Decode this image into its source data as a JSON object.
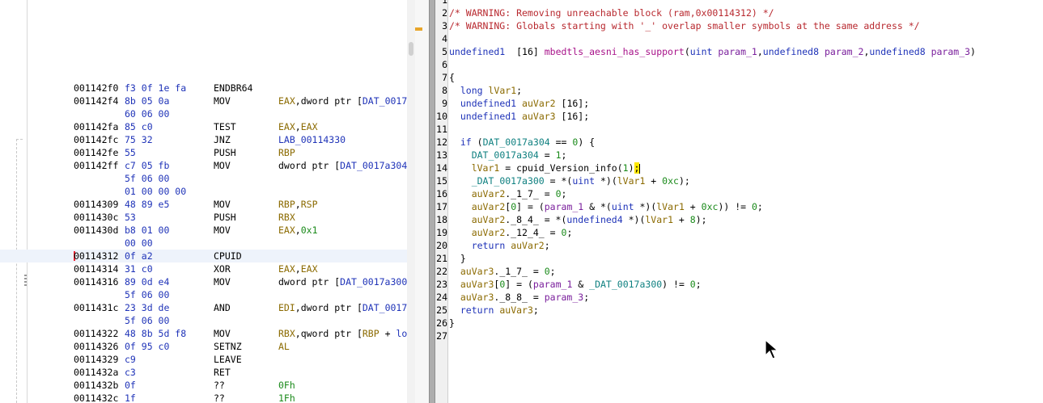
{
  "listing": {
    "rows": [
      {
        "addr": "001142f0",
        "bytes": "f3 0f 1e fa",
        "mnemonic": "ENDBR64",
        "operands": []
      },
      {
        "addr": "001142f4",
        "bytes": "8b 05 0a",
        "mnemonic": "MOV",
        "operands": [
          {
            "t": "EAX",
            "k": "reg"
          },
          {
            "t": ",dword ptr [",
            "k": "plain"
          },
          {
            "t": "DAT_0017",
            "k": "data"
          }
        ]
      },
      {
        "addr": "",
        "bytes": "60 06 00",
        "mnemonic": "",
        "operands": []
      },
      {
        "addr": "001142fa",
        "bytes": "85 c0",
        "mnemonic": "TEST",
        "operands": [
          {
            "t": "EAX",
            "k": "reg"
          },
          {
            "t": ",",
            "k": "plain"
          },
          {
            "t": "EAX",
            "k": "reg"
          }
        ]
      },
      {
        "addr": "001142fc",
        "bytes": "75 32",
        "mnemonic": "JNZ",
        "operands": [
          {
            "t": "LAB_00114330",
            "k": "lab"
          }
        ]
      },
      {
        "addr": "001142fe",
        "bytes": "55",
        "mnemonic": "PUSH",
        "operands": [
          {
            "t": "RBP",
            "k": "reg"
          }
        ]
      },
      {
        "addr": "001142ff",
        "bytes": "c7 05 fb",
        "mnemonic": "MOV",
        "operands": [
          {
            "t": "dword ptr [",
            "k": "plain"
          },
          {
            "t": "DAT_0017a304",
            "k": "data"
          }
        ]
      },
      {
        "addr": "",
        "bytes": "5f 06 00",
        "mnemonic": "",
        "operands": []
      },
      {
        "addr": "",
        "bytes": "01 00 00 00",
        "mnemonic": "",
        "operands": []
      },
      {
        "addr": "00114309",
        "bytes": "48 89 e5",
        "mnemonic": "MOV",
        "operands": [
          {
            "t": "RBP",
            "k": "reg"
          },
          {
            "t": ",",
            "k": "plain"
          },
          {
            "t": "RSP",
            "k": "reg"
          }
        ]
      },
      {
        "addr": "0011430c",
        "bytes": "53",
        "mnemonic": "PUSH",
        "operands": [
          {
            "t": "RBX",
            "k": "reg"
          }
        ]
      },
      {
        "addr": "0011430d",
        "bytes": "b8 01 00",
        "mnemonic": "MOV",
        "operands": [
          {
            "t": "EAX",
            "k": "reg"
          },
          {
            "t": ",",
            "k": "plain"
          },
          {
            "t": "0x1",
            "k": "num"
          }
        ]
      },
      {
        "addr": "",
        "bytes": "00 00",
        "mnemonic": "",
        "operands": []
      },
      {
        "addr": "00114312",
        "bytes": "0f a2",
        "mnemonic": "CPUID",
        "operands": [],
        "highlight": true
      },
      {
        "addr": "00114314",
        "bytes": "31 c0",
        "mnemonic": "XOR",
        "operands": [
          {
            "t": "EAX",
            "k": "reg"
          },
          {
            "t": ",",
            "k": "plain"
          },
          {
            "t": "EAX",
            "k": "reg"
          }
        ]
      },
      {
        "addr": "00114316",
        "bytes": "89 0d e4",
        "mnemonic": "MOV",
        "operands": [
          {
            "t": "dword ptr [",
            "k": "plain"
          },
          {
            "t": "DAT_0017a300",
            "k": "data"
          }
        ]
      },
      {
        "addr": "",
        "bytes": "5f 06 00",
        "mnemonic": "",
        "operands": []
      },
      {
        "addr": "0011431c",
        "bytes": "23 3d de",
        "mnemonic": "AND",
        "operands": [
          {
            "t": "EDI",
            "k": "reg"
          },
          {
            "t": ",dword ptr [",
            "k": "plain"
          },
          {
            "t": "DAT_0017",
            "k": "data"
          }
        ]
      },
      {
        "addr": "",
        "bytes": "5f 06 00",
        "mnemonic": "",
        "operands": []
      },
      {
        "addr": "00114322",
        "bytes": "48 8b 5d f8",
        "mnemonic": "MOV",
        "operands": [
          {
            "t": "RBX",
            "k": "reg"
          },
          {
            "t": ",qword ptr [",
            "k": "plain"
          },
          {
            "t": "RBP",
            "k": "reg"
          },
          {
            "t": " + ",
            "k": "plain"
          },
          {
            "t": "lo",
            "k": "lab"
          }
        ]
      },
      {
        "addr": "00114326",
        "bytes": "0f 95 c0",
        "mnemonic": "SETNZ",
        "operands": [
          {
            "t": "AL",
            "k": "reg"
          }
        ]
      },
      {
        "addr": "00114329",
        "bytes": "c9",
        "mnemonic": "LEAVE",
        "operands": []
      },
      {
        "addr": "0011432a",
        "bytes": "c3",
        "mnemonic": "RET",
        "operands": []
      },
      {
        "addr": "0011432b",
        "bytes": "0f",
        "mnemonic": "??",
        "operands": [
          {
            "t": "0Fh",
            "k": "num"
          }
        ]
      },
      {
        "addr": "0011432c",
        "bytes": "1f",
        "mnemonic": "??",
        "operands": [
          {
            "t": "1Fh",
            "k": "num"
          }
        ]
      }
    ]
  },
  "decompiler": {
    "line_numbers": [
      "1",
      "2",
      "3",
      "4",
      "5",
      "6",
      "7",
      "8",
      "9",
      "10",
      "11",
      "12",
      "13",
      "14",
      "15",
      "16",
      "17",
      "18",
      "19",
      "20",
      "21",
      "22",
      "23",
      "24",
      "25",
      "26",
      "27"
    ],
    "lines": [
      [],
      [
        {
          "t": "/* WARNING: Removing unreachable block (ram,0x00114312) */",
          "k": "cm"
        }
      ],
      [
        {
          "t": "/* WARNING: Globals starting with '_' overlap smaller symbols at the same address */",
          "k": "cm"
        }
      ],
      [],
      [
        {
          "t": "undefined1",
          "k": "ty"
        },
        {
          "t": "  [16] ",
          "k": "pl"
        },
        {
          "t": "mbedtls_aesni_has_support",
          "k": "fn"
        },
        {
          "t": "(",
          "k": "pl"
        },
        {
          "t": "uint",
          "k": "ty"
        },
        {
          "t": " ",
          "k": "pl"
        },
        {
          "t": "param_1",
          "k": "pm"
        },
        {
          "t": ",",
          "k": "pl"
        },
        {
          "t": "undefined8",
          "k": "ty"
        },
        {
          "t": " ",
          "k": "pl"
        },
        {
          "t": "param_2",
          "k": "pm"
        },
        {
          "t": ",",
          "k": "pl"
        },
        {
          "t": "undefined8",
          "k": "ty"
        },
        {
          "t": " ",
          "k": "pl"
        },
        {
          "t": "param_3",
          "k": "pm"
        },
        {
          "t": ")",
          "k": "pl"
        }
      ],
      [],
      [
        {
          "t": "{",
          "k": "pl"
        }
      ],
      [
        {
          "t": "  ",
          "k": "pl"
        },
        {
          "t": "long",
          "k": "ty"
        },
        {
          "t": " ",
          "k": "pl"
        },
        {
          "t": "lVar1",
          "k": "lv"
        },
        {
          "t": ";",
          "k": "pl"
        }
      ],
      [
        {
          "t": "  ",
          "k": "pl"
        },
        {
          "t": "undefined1",
          "k": "ty"
        },
        {
          "t": " ",
          "k": "pl"
        },
        {
          "t": "auVar2",
          "k": "lv"
        },
        {
          "t": " [16];",
          "k": "pl"
        }
      ],
      [
        {
          "t": "  ",
          "k": "pl"
        },
        {
          "t": "undefined1",
          "k": "ty"
        },
        {
          "t": " ",
          "k": "pl"
        },
        {
          "t": "auVar3",
          "k": "lv"
        },
        {
          "t": " [16];",
          "k": "pl"
        }
      ],
      [],
      [
        {
          "t": "  ",
          "k": "pl"
        },
        {
          "t": "if",
          "k": "kw"
        },
        {
          "t": " (",
          "k": "pl"
        },
        {
          "t": "DAT_0017a304",
          "k": "gl"
        },
        {
          "t": " == ",
          "k": "pl"
        },
        {
          "t": "0",
          "k": "nm"
        },
        {
          "t": ") {",
          "k": "pl"
        }
      ],
      [
        {
          "t": "    ",
          "k": "pl"
        },
        {
          "t": "DAT_0017a304",
          "k": "gl"
        },
        {
          "t": " = ",
          "k": "pl"
        },
        {
          "t": "1",
          "k": "nm"
        },
        {
          "t": ";",
          "k": "pl"
        }
      ],
      [
        {
          "t": "    ",
          "k": "pl"
        },
        {
          "t": "lVar1",
          "k": "lv"
        },
        {
          "t": " = cpuid_Version_info(",
          "k": "pl"
        },
        {
          "t": "1",
          "k": "nm"
        },
        {
          "t": ")",
          "k": "pl"
        },
        {
          "t": ";",
          "k": "hl"
        },
        {
          "t": "",
          "k": "caret"
        }
      ],
      [
        {
          "t": "    ",
          "k": "pl"
        },
        {
          "t": "_DAT_0017a300",
          "k": "gl"
        },
        {
          "t": " = *(",
          "k": "pl"
        },
        {
          "t": "uint",
          "k": "ty"
        },
        {
          "t": " *)(",
          "k": "pl"
        },
        {
          "t": "lVar1",
          "k": "lv"
        },
        {
          "t": " + ",
          "k": "pl"
        },
        {
          "t": "0xc",
          "k": "nm"
        },
        {
          "t": ");",
          "k": "pl"
        }
      ],
      [
        {
          "t": "    ",
          "k": "pl"
        },
        {
          "t": "auVar2",
          "k": "lv"
        },
        {
          "t": "._1_7_ = ",
          "k": "pl"
        },
        {
          "t": "0",
          "k": "nm"
        },
        {
          "t": ";",
          "k": "pl"
        }
      ],
      [
        {
          "t": "    ",
          "k": "pl"
        },
        {
          "t": "auVar2",
          "k": "lv"
        },
        {
          "t": "[",
          "k": "pl"
        },
        {
          "t": "0",
          "k": "nm"
        },
        {
          "t": "] = (",
          "k": "pl"
        },
        {
          "t": "param_1",
          "k": "pm"
        },
        {
          "t": " & *(",
          "k": "pl"
        },
        {
          "t": "uint",
          "k": "ty"
        },
        {
          "t": " *)(",
          "k": "pl"
        },
        {
          "t": "lVar1",
          "k": "lv"
        },
        {
          "t": " + ",
          "k": "pl"
        },
        {
          "t": "0xc",
          "k": "nm"
        },
        {
          "t": ")) != ",
          "k": "pl"
        },
        {
          "t": "0",
          "k": "nm"
        },
        {
          "t": ";",
          "k": "pl"
        }
      ],
      [
        {
          "t": "    ",
          "k": "pl"
        },
        {
          "t": "auVar2",
          "k": "lv"
        },
        {
          "t": "._8_4_ = *(",
          "k": "pl"
        },
        {
          "t": "undefined4",
          "k": "ty"
        },
        {
          "t": " *)(",
          "k": "pl"
        },
        {
          "t": "lVar1",
          "k": "lv"
        },
        {
          "t": " + ",
          "k": "pl"
        },
        {
          "t": "8",
          "k": "nm"
        },
        {
          "t": ");",
          "k": "pl"
        }
      ],
      [
        {
          "t": "    ",
          "k": "pl"
        },
        {
          "t": "auVar2",
          "k": "lv"
        },
        {
          "t": "._12_4_ = ",
          "k": "pl"
        },
        {
          "t": "0",
          "k": "nm"
        },
        {
          "t": ";",
          "k": "pl"
        }
      ],
      [
        {
          "t": "    ",
          "k": "pl"
        },
        {
          "t": "return",
          "k": "kw"
        },
        {
          "t": " ",
          "k": "pl"
        },
        {
          "t": "auVar2",
          "k": "lv"
        },
        {
          "t": ";",
          "k": "pl"
        }
      ],
      [
        {
          "t": "  }",
          "k": "pl"
        }
      ],
      [
        {
          "t": "  ",
          "k": "pl"
        },
        {
          "t": "auVar3",
          "k": "lv"
        },
        {
          "t": "._1_7_ = ",
          "k": "pl"
        },
        {
          "t": "0",
          "k": "nm"
        },
        {
          "t": ";",
          "k": "pl"
        }
      ],
      [
        {
          "t": "  ",
          "k": "pl"
        },
        {
          "t": "auVar3",
          "k": "lv"
        },
        {
          "t": "[",
          "k": "pl"
        },
        {
          "t": "0",
          "k": "nm"
        },
        {
          "t": "] = (",
          "k": "pl"
        },
        {
          "t": "param_1",
          "k": "pm"
        },
        {
          "t": " & ",
          "k": "pl"
        },
        {
          "t": "_DAT_0017a300",
          "k": "gl"
        },
        {
          "t": ") != ",
          "k": "pl"
        },
        {
          "t": "0",
          "k": "nm"
        },
        {
          "t": ";",
          "k": "pl"
        }
      ],
      [
        {
          "t": "  ",
          "k": "pl"
        },
        {
          "t": "auVar3",
          "k": "lv"
        },
        {
          "t": "._8_8_ = ",
          "k": "pl"
        },
        {
          "t": "param_3",
          "k": "pm"
        },
        {
          "t": ";",
          "k": "pl"
        }
      ],
      [
        {
          "t": "  ",
          "k": "pl"
        },
        {
          "t": "return",
          "k": "kw"
        },
        {
          "t": " ",
          "k": "pl"
        },
        {
          "t": "auVar3",
          "k": "lv"
        },
        {
          "t": ";",
          "k": "pl"
        }
      ],
      [
        {
          "t": "}",
          "k": "pl"
        }
      ],
      []
    ]
  },
  "icons": {
    "mouse": "mouse-pointer-icon"
  },
  "colors": {
    "comment": "#b8292f",
    "type": "#1f33b8",
    "function": "#a8138a",
    "param": "#7a1f9c",
    "local": "#8b6a00",
    "global": "#0f8080",
    "number": "#1a8a1a",
    "highlight": "#ffe900"
  }
}
